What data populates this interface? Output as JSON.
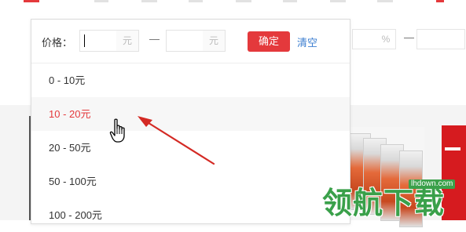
{
  "price_filter": {
    "label": "价格：",
    "min_value": "",
    "min_unit": "元",
    "dash": "—",
    "max_value": "",
    "max_unit": "元",
    "confirm_label": "确定",
    "clear_label": "清空"
  },
  "price_ranges": [
    {
      "label": "0 - 10元",
      "hovered": false
    },
    {
      "label": "10 - 20元",
      "hovered": true
    },
    {
      "label": "20 - 50元",
      "hovered": false
    },
    {
      "label": "50 - 100元",
      "hovered": false
    },
    {
      "label": "100 - 200元",
      "hovered": false
    }
  ],
  "background_filter": {
    "unit": "%",
    "dash": "—"
  },
  "watermark": {
    "chars": "领航下载",
    "url": "lhdown.com"
  },
  "colors": {
    "accent_red": "#e4393c",
    "link_blue": "#3b7ed0",
    "watermark_green": "#3aa04a"
  }
}
